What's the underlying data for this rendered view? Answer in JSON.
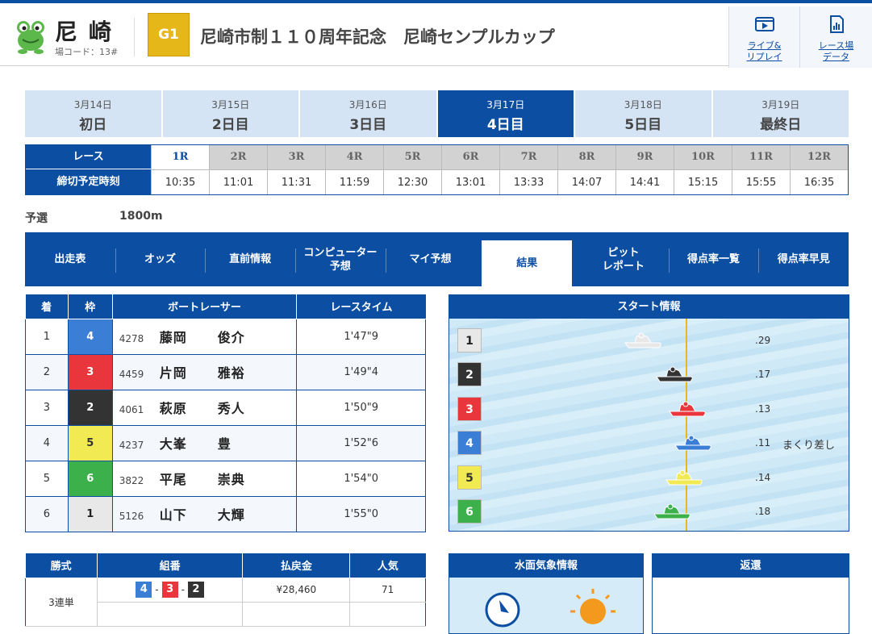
{
  "header": {
    "venue_name": "尼崎",
    "venue_code": "場コード：13#",
    "grade": "G1",
    "title": "尼崎市制１１０周年記念　尼崎センプルカップ",
    "live_label_1": "ライブ&",
    "live_label_2": "リプレイ",
    "data_label_1": "レース場",
    "data_label_2": "データ"
  },
  "days": [
    {
      "date": "3月14日",
      "name": "初日",
      "active": false
    },
    {
      "date": "3月15日",
      "name": "2日目",
      "active": false
    },
    {
      "date": "3月16日",
      "name": "3日目",
      "active": false
    },
    {
      "date": "3月17日",
      "name": "4日目",
      "active": true
    },
    {
      "date": "3月18日",
      "name": "5日目",
      "active": false
    },
    {
      "date": "3月19日",
      "name": "最終日",
      "active": false
    }
  ],
  "race_grid": {
    "race_label": "レース",
    "deadline_label": "締切予定時刻",
    "races": [
      "1R",
      "2R",
      "3R",
      "4R",
      "5R",
      "6R",
      "7R",
      "8R",
      "9R",
      "10R",
      "11R",
      "12R"
    ],
    "times": [
      "10:35",
      "11:01",
      "11:31",
      "11:59",
      "12:30",
      "13:01",
      "13:33",
      "14:07",
      "14:41",
      "15:15",
      "15:55",
      "16:35"
    ],
    "active_race": 0
  },
  "race_info": {
    "type": "予選",
    "distance": "1800m"
  },
  "tabs": [
    {
      "label": "出走表",
      "sub": ""
    },
    {
      "label": "オッズ",
      "sub": ""
    },
    {
      "label": "直前情報",
      "sub": ""
    },
    {
      "label": "コンピューター",
      "sub": "予想"
    },
    {
      "label": "マイ予想",
      "sub": ""
    },
    {
      "label": "結果",
      "sub": ""
    },
    {
      "label": "ピット",
      "sub": "レポート"
    },
    {
      "label": "得点率一覧",
      "sub": ""
    },
    {
      "label": "得点率早見",
      "sub": ""
    }
  ],
  "active_tab": 5,
  "results": {
    "headers": [
      "着",
      "枠",
      "ボートレーサー",
      "レースタイム"
    ],
    "rows": [
      {
        "place": "1",
        "frame": "4",
        "reg": "4278",
        "family": "藤岡",
        "given": "俊介",
        "time": "1'47\"9"
      },
      {
        "place": "2",
        "frame": "3",
        "reg": "4459",
        "family": "片岡",
        "given": "雅裕",
        "time": "1'49\"4"
      },
      {
        "place": "3",
        "frame": "2",
        "reg": "4061",
        "family": "萩原",
        "given": "秀人",
        "time": "1'50\"9"
      },
      {
        "place": "4",
        "frame": "5",
        "reg": "4237",
        "family": "大峯",
        "given": "豊",
        "time": "1'52\"6"
      },
      {
        "place": "5",
        "frame": "6",
        "reg": "3822",
        "family": "平尾",
        "given": "崇典",
        "time": "1'54\"0"
      },
      {
        "place": "6",
        "frame": "1",
        "reg": "5126",
        "family": "山下",
        "given": "大輝",
        "time": "1'55\"0"
      }
    ]
  },
  "start_info": {
    "title": "スタート情報",
    "rows": [
      {
        "lane": "1",
        "st": ".29",
        "tech": ""
      },
      {
        "lane": "2",
        "st": ".17",
        "tech": ""
      },
      {
        "lane": "3",
        "st": ".13",
        "tech": ""
      },
      {
        "lane": "4",
        "st": ".11",
        "tech": "まくり差し"
      },
      {
        "lane": "5",
        "st": ".14",
        "tech": ""
      },
      {
        "lane": "6",
        "st": ".18",
        "tech": ""
      }
    ]
  },
  "payout": {
    "headers": [
      "勝式",
      "組番",
      "払戻金",
      "人気"
    ],
    "bet_type": "3連単",
    "combo": [
      "4",
      "3",
      "2"
    ],
    "amount": "¥28,460",
    "popularity": "71"
  },
  "weather": {
    "title": "水面気象情報"
  },
  "refund": {
    "title": "返還"
  },
  "colors": {
    "brand": "#0b4ea2",
    "lane1": "#e8e8e8",
    "lane2": "#333333",
    "lane3": "#e8363c",
    "lane4": "#3a7ed5",
    "lane5": "#f2ea52",
    "lane6": "#3cb04a"
  }
}
